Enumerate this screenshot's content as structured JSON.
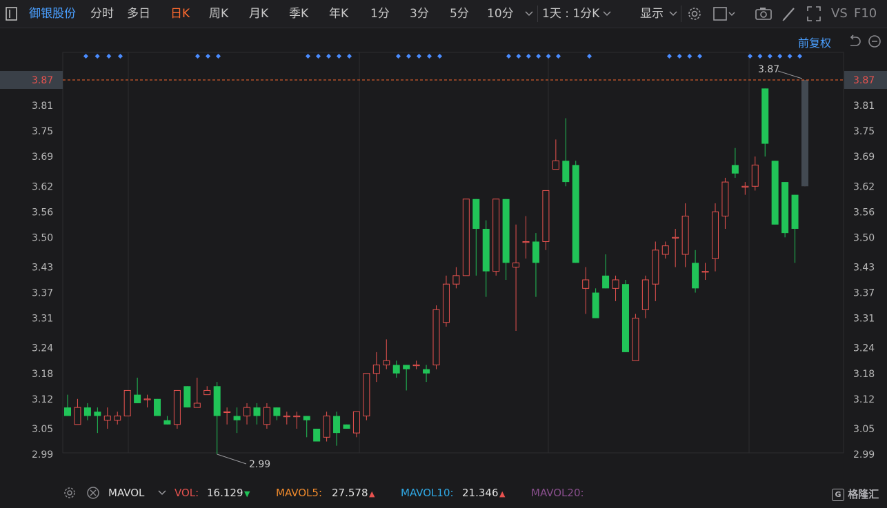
{
  "toolbar": {
    "stock_name": "御银股份",
    "periods": [
      "分时",
      "多日",
      "日K",
      "周K",
      "月K",
      "季K",
      "年K",
      "1分",
      "3分",
      "5分",
      "10分"
    ],
    "active_period": "日K",
    "interval_label": "1天 : 1分K",
    "display_label": "显示",
    "vs_label": "VS",
    "f10_label": "F10",
    "adjust_label": "前复权"
  },
  "icons": [
    "panel-icon",
    "chevron-down-icon",
    "gear-icon",
    "square-icon",
    "camera-icon",
    "pencil-icon",
    "expand-icon",
    "back-icon",
    "minus-circle-icon",
    "settings-icon",
    "close-circle-icon"
  ],
  "indicator_bar": {
    "name": "MAVOL",
    "vol_label": "VOL:",
    "vol_value": "16.129",
    "mavol5_label": "MAVOL5:",
    "mavol5_value": "27.578",
    "mavol10_label": "MAVOL10:",
    "mavol10_value": "21.346",
    "mavol20_label": "MAVOL20:"
  },
  "watermark": "格隆汇",
  "colors": {
    "up": "#e8524f",
    "down": "#21c458",
    "accent": "#ff6a2e",
    "link": "#4a9fff",
    "marker": "#4a8cff"
  },
  "chart_data": {
    "type": "candlestick",
    "ylim": [
      2.95,
      3.89
    ],
    "yticks": [
      "3.87",
      "3.81",
      "3.75",
      "3.69",
      "3.62",
      "3.56",
      "3.50",
      "3.43",
      "3.37",
      "3.31",
      "3.24",
      "3.18",
      "3.12",
      "3.05",
      "2.99"
    ],
    "current_price": "3.87",
    "high_label": "3.87",
    "low_label": "2.99",
    "candles": [
      [
        3.1,
        3.08,
        3.13,
        3.08
      ],
      [
        3.06,
        3.1,
        3.12,
        3.06
      ],
      [
        3.1,
        3.08,
        3.11,
        3.07
      ],
      [
        3.09,
        3.08,
        3.1,
        3.04
      ],
      [
        3.07,
        3.08,
        3.1,
        3.05
      ],
      [
        3.07,
        3.08,
        3.09,
        3.06
      ],
      [
        3.08,
        3.14,
        3.14,
        3.08
      ],
      [
        3.13,
        3.11,
        3.17,
        3.11
      ],
      [
        3.12,
        3.12,
        3.13,
        3.1
      ],
      [
        3.12,
        3.08,
        3.12,
        3.08
      ],
      [
        3.07,
        3.06,
        3.08,
        3.06
      ],
      [
        3.06,
        3.14,
        3.14,
        3.05
      ],
      [
        3.15,
        3.1,
        3.15,
        3.1
      ],
      [
        3.1,
        3.11,
        3.17,
        3.1
      ],
      [
        3.13,
        3.14,
        3.15,
        3.13
      ],
      [
        3.15,
        3.08,
        3.16,
        2.99
      ],
      [
        3.09,
        3.09,
        3.1,
        3.06
      ],
      [
        3.08,
        3.07,
        3.1,
        3.04
      ],
      [
        3.08,
        3.1,
        3.11,
        3.06
      ],
      [
        3.1,
        3.08,
        3.11,
        3.06
      ],
      [
        3.06,
        3.1,
        3.11,
        3.05
      ],
      [
        3.1,
        3.08,
        3.1,
        3.07
      ],
      [
        3.08,
        3.08,
        3.09,
        3.06
      ],
      [
        3.08,
        3.08,
        3.09,
        3.05
      ],
      [
        3.08,
        3.07,
        3.08,
        3.03
      ],
      [
        3.05,
        3.02,
        3.05,
        3.02
      ],
      [
        3.03,
        3.08,
        3.09,
        3.02
      ],
      [
        3.08,
        3.04,
        3.09,
        3.01
      ],
      [
        3.06,
        3.05,
        3.06,
        3.05
      ],
      [
        3.04,
        3.09,
        3.09,
        3.03
      ],
      [
        3.08,
        3.18,
        3.18,
        3.07
      ],
      [
        3.18,
        3.2,
        3.23,
        3.16
      ],
      [
        3.2,
        3.21,
        3.26,
        3.19
      ],
      [
        3.2,
        3.18,
        3.21,
        3.17
      ],
      [
        3.2,
        3.19,
        3.2,
        3.14
      ],
      [
        3.2,
        3.2,
        3.21,
        3.19
      ],
      [
        3.19,
        3.18,
        3.2,
        3.16
      ],
      [
        3.2,
        3.33,
        3.34,
        3.19
      ],
      [
        3.3,
        3.39,
        3.41,
        3.29
      ],
      [
        3.39,
        3.41,
        3.43,
        3.38
      ],
      [
        3.41,
        3.59,
        3.59,
        3.41
      ],
      [
        3.59,
        3.52,
        3.59,
        3.41
      ],
      [
        3.52,
        3.42,
        3.54,
        3.36
      ],
      [
        3.42,
        3.59,
        3.59,
        3.41
      ],
      [
        3.59,
        3.44,
        3.59,
        3.4
      ],
      [
        3.43,
        3.44,
        3.53,
        3.28
      ],
      [
        3.49,
        3.49,
        3.55,
        3.45
      ],
      [
        3.49,
        3.44,
        3.51,
        3.36
      ],
      [
        3.49,
        3.61,
        3.61,
        3.47
      ],
      [
        3.66,
        3.68,
        3.73,
        3.66
      ],
      [
        3.68,
        3.63,
        3.78,
        3.62
      ],
      [
        3.67,
        3.44,
        3.68,
        3.44
      ],
      [
        3.38,
        3.4,
        3.43,
        3.32
      ],
      [
        3.37,
        3.31,
        3.38,
        3.31
      ],
      [
        3.41,
        3.38,
        3.46,
        3.38
      ],
      [
        3.38,
        3.4,
        3.41,
        3.35
      ],
      [
        3.39,
        3.23,
        3.4,
        3.23
      ],
      [
        3.21,
        3.31,
        3.32,
        3.21
      ],
      [
        3.33,
        3.4,
        3.41,
        3.31
      ],
      [
        3.39,
        3.47,
        3.49,
        3.35
      ],
      [
        3.46,
        3.48,
        3.49,
        3.45
      ],
      [
        3.5,
        3.5,
        3.52,
        3.43
      ],
      [
        3.46,
        3.55,
        3.58,
        3.43
      ],
      [
        3.44,
        3.38,
        3.47,
        3.37
      ],
      [
        3.42,
        3.42,
        3.44,
        3.4
      ],
      [
        3.45,
        3.56,
        3.58,
        3.42
      ],
      [
        3.55,
        3.63,
        3.64,
        3.52
      ],
      [
        3.67,
        3.65,
        3.71,
        3.64
      ],
      [
        3.62,
        3.62,
        3.63,
        3.6
      ],
      [
        3.62,
        3.67,
        3.69,
        3.61
      ],
      [
        3.85,
        3.72,
        3.85,
        3.69
      ],
      [
        3.68,
        3.53,
        3.68,
        3.53
      ],
      [
        3.63,
        3.51,
        3.63,
        3.5
      ],
      [
        3.6,
        3.52,
        3.6,
        3.44
      ],
      [
        3.62,
        3.87,
        3.87,
        3.62
      ]
    ],
    "marker_runs": [
      [
        125,
        175,
        4
      ],
      [
        287,
        317,
        3
      ],
      [
        447,
        507,
        5
      ],
      [
        578,
        638,
        5
      ],
      [
        738,
        810,
        6
      ],
      [
        855,
        855,
        1
      ],
      [
        971,
        1015,
        4
      ],
      [
        1088,
        1160,
        6
      ]
    ]
  }
}
